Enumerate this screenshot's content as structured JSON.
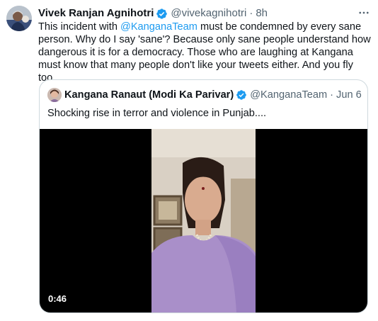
{
  "tweet": {
    "author_name": "Vivek Ranjan Agnihotri",
    "handle": "@vivekagnihotri",
    "separator": "·",
    "time": "8h",
    "text": {
      "part1": "This incident with ",
      "mention": "@KanganaTeam",
      "part2": " must be condemned by every sane person. Why do I say 'sane'? Because only sane people understand how dangerous it is for a democracy. Those who are laughing at Kangana must know that many people don't like your tweets either. And you fly too."
    },
    "icons": {
      "verified": "verified-badge-icon",
      "more": "more-options-icon"
    },
    "colors": {
      "accent": "#1d9bf0",
      "secondary_text": "#536471",
      "border": "#cfd9de"
    }
  },
  "quoted_tweet": {
    "author_name": "Kangana Ranaut (Modi Ka Parivar)",
    "handle": "@KanganaTeam",
    "separator": "·",
    "date": "Jun 6",
    "text": "Shocking rise in terror and violence in Punjab....",
    "video": {
      "duration": "0:46"
    }
  }
}
